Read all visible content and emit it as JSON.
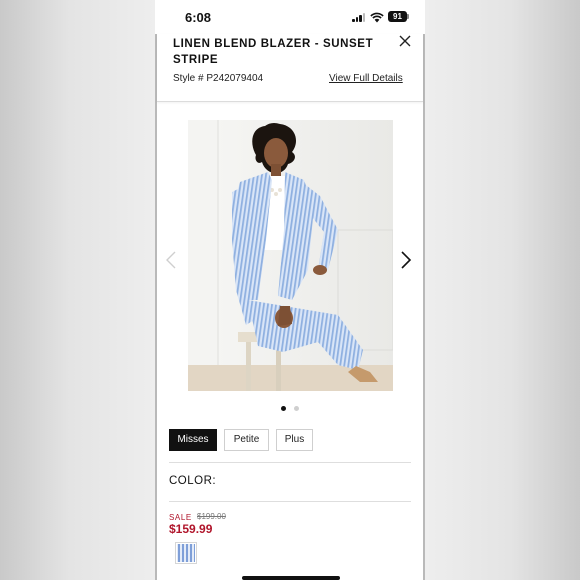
{
  "status_bar": {
    "time": "6:08",
    "battery": "91"
  },
  "product": {
    "title": "LINEN BLEND BLAZER - SUNSET STRIPE",
    "style_number": "Style # P242079404",
    "details_link": "View Full Details",
    "image_alt": "Model wearing a blue and white striped linen blend blazer",
    "carousel_pages": 2,
    "carousel_current": 1
  },
  "size_tabs": [
    {
      "label": "Misses",
      "active": true
    },
    {
      "label": "Petite",
      "active": false
    },
    {
      "label": "Plus",
      "active": false
    }
  ],
  "color_section": {
    "label": "COLOR:"
  },
  "pricing": {
    "sale_label": "SALE",
    "original_price": "$199.00",
    "sale_price": "$159.99"
  },
  "icons": {
    "close": "close-icon",
    "prev": "chevron-left-icon",
    "next": "chevron-right-icon",
    "signal": "cellular-signal-icon",
    "wifi": "wifi-icon",
    "battery": "battery-icon"
  },
  "colors": {
    "sale_red": "#b0152b",
    "active_tab": "#111111",
    "stripe_blue": "#9fb8e3"
  }
}
